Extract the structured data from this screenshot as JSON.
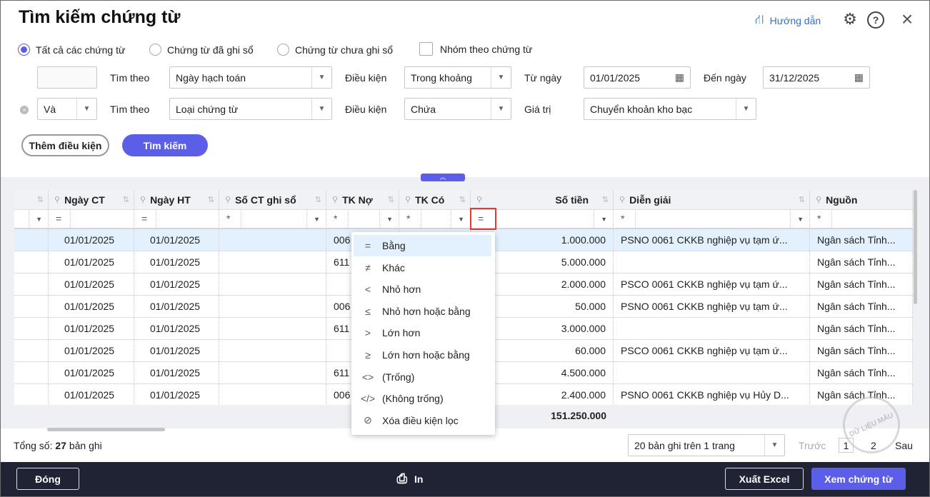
{
  "title": "Tìm kiếm chứng từ",
  "header": {
    "help": "Hướng dẫn"
  },
  "filters": {
    "radios": [
      "Tất cả các chứng từ",
      "Chứng từ đã ghi sổ",
      "Chứng từ chưa ghi sổ"
    ],
    "group_checkbox": "Nhóm theo chứng từ",
    "row1": {
      "search_by_label": "Tìm theo",
      "search_by": "Ngày hạch toán",
      "cond_label": "Điều kiện",
      "cond": "Trong khoảng",
      "from_label": "Từ ngày",
      "from": "01/01/2025",
      "to_label": "Đến ngày",
      "to": "31/12/2025"
    },
    "row2": {
      "joiner": "Và",
      "search_by_label": "Tìm theo",
      "search_by": "Loại chứng từ",
      "cond_label": "Điều kiện",
      "cond": "Chứa",
      "value_label": "Giá trị",
      "value": "Chuyển khoản kho bạc"
    },
    "add_condition": "Thêm điều kiện",
    "search": "Tìm kiếm"
  },
  "table": {
    "columns": [
      "Ngày CT",
      "Ngày HT",
      "Số CT ghi sổ",
      "TK Nợ",
      "TK Có",
      "Số tiền",
      "Diễn giải",
      "Nguồn"
    ],
    "filter_ops": [
      "=",
      "=",
      "*",
      "*",
      "*",
      "=",
      "*",
      "*"
    ],
    "rows": [
      [
        "01/01/2025",
        "01/01/2025",
        "",
        "006",
        "",
        "1.000.000",
        "PSNO 0061 CKKB nghiệp vụ tạm ứ...",
        "Ngân sách Tỉnh..."
      ],
      [
        "01/01/2025",
        "01/01/2025",
        "",
        "611",
        "",
        "5.000.000",
        "",
        "Ngân sách Tỉnh..."
      ],
      [
        "01/01/2025",
        "01/01/2025",
        "",
        "",
        "",
        "2.000.000",
        "PSCO 0061 CKKB nghiệp vụ tạm ứ...",
        "Ngân sách Tỉnh..."
      ],
      [
        "01/01/2025",
        "01/01/2025",
        "",
        "006",
        "",
        "50.000",
        "PSNO 0061 CKKB nghiệp vụ tạm ứ...",
        "Ngân sách Tỉnh..."
      ],
      [
        "01/01/2025",
        "01/01/2025",
        "",
        "611",
        "",
        "3.000.000",
        "",
        "Ngân sách Tỉnh..."
      ],
      [
        "01/01/2025",
        "01/01/2025",
        "",
        "",
        "",
        "60.000",
        "PSCO 0061 CKKB nghiệp vụ tạm ứ...",
        "Ngân sách Tỉnh..."
      ],
      [
        "01/01/2025",
        "01/01/2025",
        "",
        "611",
        "",
        "4.500.000",
        "",
        "Ngân sách Tỉnh..."
      ],
      [
        "01/01/2025",
        "01/01/2025",
        "",
        "006",
        "",
        "2.400.000",
        "PSNO 0061 CKKB nghiệp vụ Hủy D...",
        "Ngân sách Tỉnh..."
      ]
    ],
    "total": "151.250.000"
  },
  "filter_menu": [
    {
      "glyph": "=",
      "label": "Bằng"
    },
    {
      "glyph": "≠",
      "label": "Khác"
    },
    {
      "glyph": "<",
      "label": "Nhỏ hơn"
    },
    {
      "glyph": "≤",
      "label": "Nhỏ hơn hoặc bằng"
    },
    {
      "glyph": ">",
      "label": "Lớn hơn"
    },
    {
      "glyph": "≥",
      "label": "Lớn hơn hoặc bằng"
    },
    {
      "glyph": "<>",
      "label": "(Trống)"
    },
    {
      "glyph": "</>",
      "label": "(Không trống)"
    },
    {
      "glyph": "⊘",
      "label": "Xóa điều kiện lọc"
    }
  ],
  "pager": {
    "total_prefix": "Tổng số:",
    "total_count": "27",
    "total_suffix": "bản ghi",
    "page_size": "20 bản ghi trên 1 trang",
    "prev": "Trước",
    "pages": [
      "1",
      "2"
    ],
    "next": "Sau"
  },
  "footer": {
    "close": "Đóng",
    "print": "In",
    "export": "Xuất Excel",
    "view": "Xem chứng từ"
  },
  "watermark": "DỮ LIỆU MẪU"
}
